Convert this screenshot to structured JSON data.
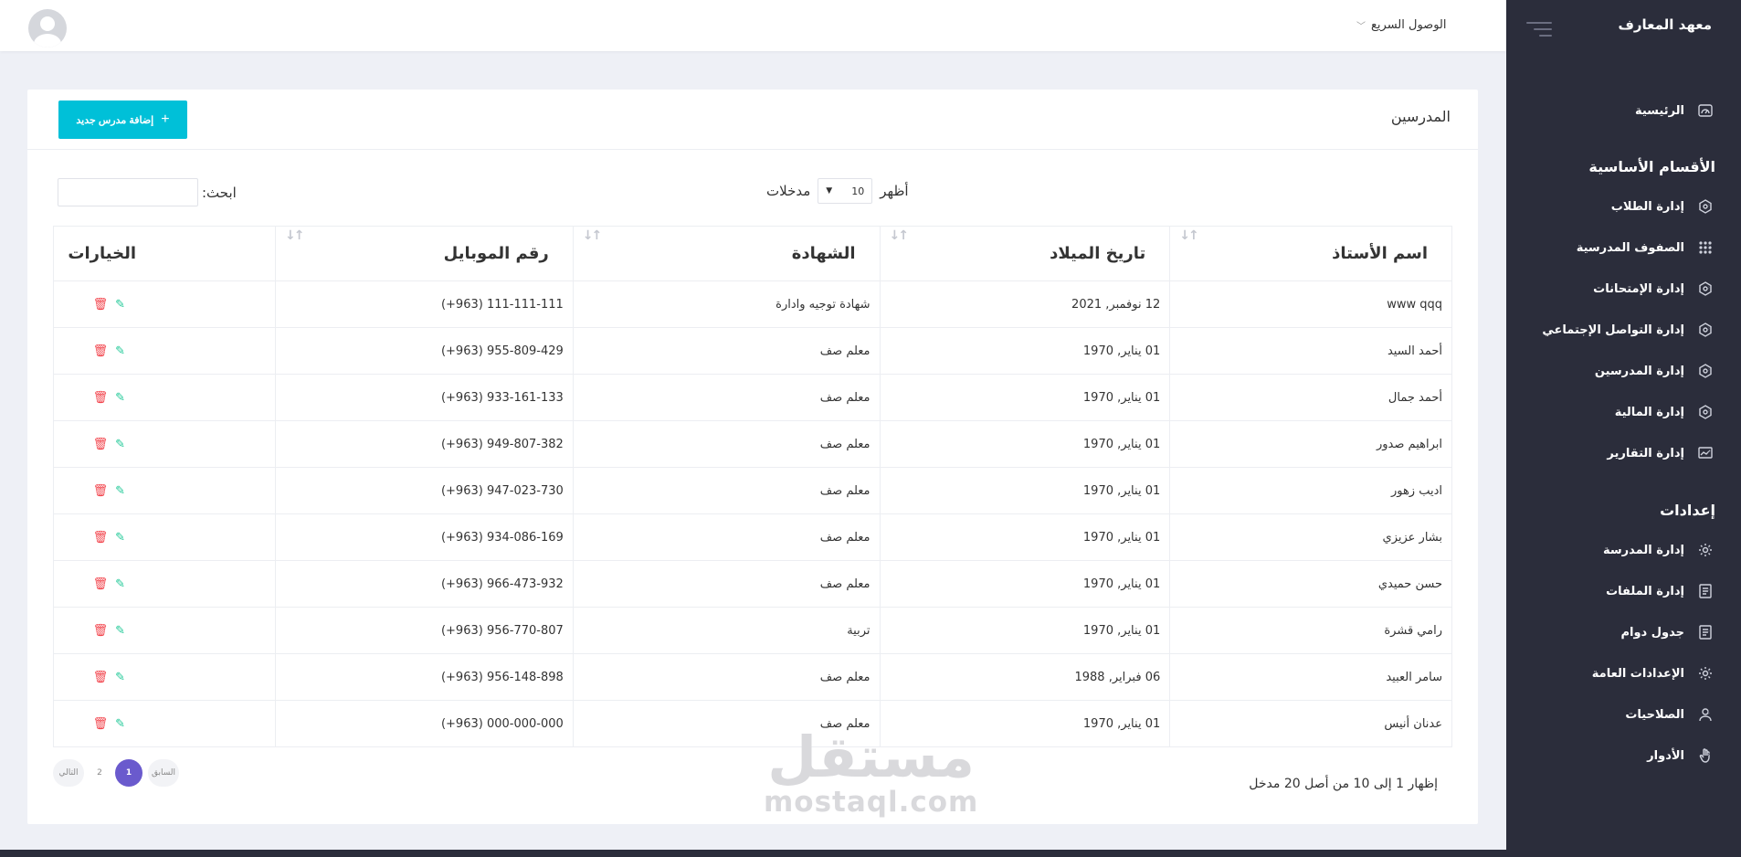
{
  "app": {
    "brand": "معهد المعارف",
    "quick_access": "الوصول السريع"
  },
  "sidebar": {
    "home": "الرئيسية",
    "section_main": "الأقسام الأساسية",
    "main_items": [
      {
        "label": "إدارة الطلاب",
        "icon": "hexagon-icon"
      },
      {
        "label": "الصفوف المدرسية",
        "icon": "grid-icon"
      },
      {
        "label": "إدارة الإمتحانات",
        "icon": "hexagon-icon"
      },
      {
        "label": "إدارة التواصل الإجتماعي",
        "icon": "hexagon-icon"
      },
      {
        "label": "إدارة المدرسين",
        "icon": "hexagon-icon"
      },
      {
        "label": "إدارة المالية",
        "icon": "hexagon-icon"
      },
      {
        "label": "إدارة التقارير",
        "icon": "chart-icon"
      }
    ],
    "section_settings": "إعدادات",
    "settings_items": [
      {
        "label": "إدارة المدرسة",
        "icon": "gear-icon"
      },
      {
        "label": "إدارة الملفات",
        "icon": "document-icon"
      },
      {
        "label": "جدول دوام",
        "icon": "document-icon"
      },
      {
        "label": "الإعدادات العامة",
        "icon": "gear-icon"
      },
      {
        "label": "الصلاحيات",
        "icon": "user-icon"
      },
      {
        "label": "الأدوار",
        "icon": "hand-icon"
      }
    ]
  },
  "page": {
    "title": "المدرسين",
    "add_button": "إضافة مدرس جديد",
    "show_label": "أظهر",
    "entries_label": "مدخلات",
    "page_size": "10",
    "search_label": "ابحث:"
  },
  "table": {
    "headers": {
      "name": "اسم الأستاذ",
      "dob": "تاريخ الميلاد",
      "cert": "الشهادة",
      "mobile": "رقم الموبايل",
      "options": "الخيارات"
    },
    "rows": [
      {
        "name": "www qqq",
        "dob": "12 نوفمبر, 2021",
        "cert": "شهادة توجيه وادارة",
        "mobile": "(+963) 111-111-111"
      },
      {
        "name": "أحمد السيد",
        "dob": "01 يناير, 1970",
        "cert": "معلم صف",
        "mobile": "(+963) 955-809-429"
      },
      {
        "name": "أحمد جمال",
        "dob": "01 يناير, 1970",
        "cert": "معلم صف",
        "mobile": "(+963) 933-161-133"
      },
      {
        "name": "ابراهيم صدور",
        "dob": "01 يناير, 1970",
        "cert": "معلم صف",
        "mobile": "(+963) 949-807-382"
      },
      {
        "name": "اديب زهور",
        "dob": "01 يناير, 1970",
        "cert": "معلم صف",
        "mobile": "(+963) 947-023-730"
      },
      {
        "name": "بشار عزيزي",
        "dob": "01 يناير, 1970",
        "cert": "معلم صف",
        "mobile": "(+963) 934-086-169"
      },
      {
        "name": "حسن حميدي",
        "dob": "01 يناير, 1970",
        "cert": "معلم صف",
        "mobile": "(+963) 966-473-932"
      },
      {
        "name": "رامي قشرة",
        "dob": "01 يناير, 1970",
        "cert": "تربية",
        "mobile": "(+963) 956-770-807"
      },
      {
        "name": "سامر العبيد",
        "dob": "06 فبراير, 1988",
        "cert": "معلم صف",
        "mobile": "(+963) 956-148-898"
      },
      {
        "name": "عدنان أنيس",
        "dob": "01 يناير, 1970",
        "cert": "معلم صف",
        "mobile": "(+963) 000-000-000"
      }
    ]
  },
  "footer": {
    "info": "إظهار 1 إلى 10 من أصل 20 مدخل",
    "prev": "السابق",
    "page1": "1",
    "page2": "2",
    "next": "التالي"
  },
  "watermark": {
    "arabic": "مستقل",
    "latin": "mostaql.com"
  },
  "colors": {
    "sidebar": "#2b2d3b",
    "accent": "#00c0d8",
    "pager_active": "#6a5acd",
    "edit": "#20c997",
    "delete": "#f2434b"
  }
}
